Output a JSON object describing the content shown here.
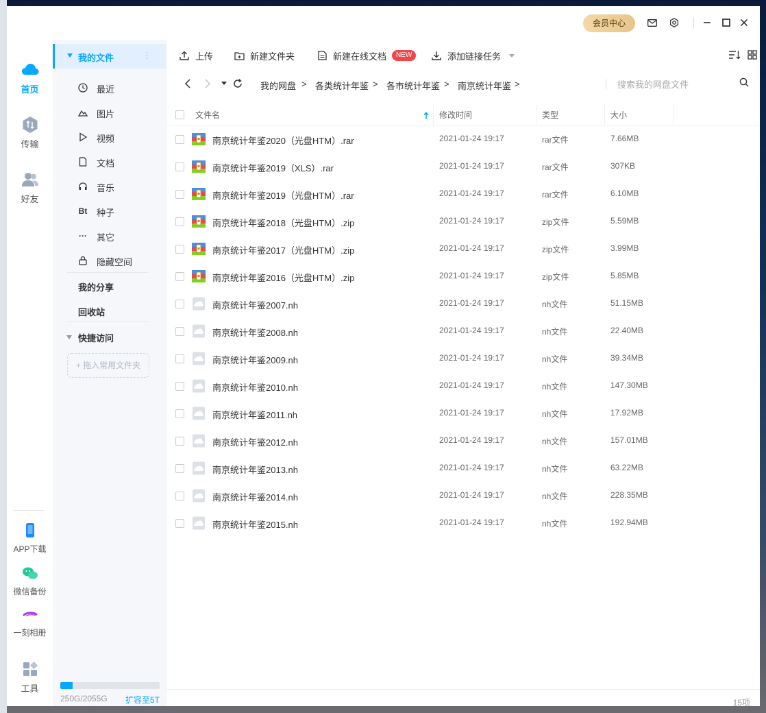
{
  "titlebar": {
    "vip_label": "会员中心",
    "icons": [
      "mail-icon",
      "settings-icon",
      "minimize-icon",
      "maximize-icon",
      "close-icon"
    ]
  },
  "leftnav": {
    "items": [
      {
        "label": "首页",
        "icon": "cloud-icon",
        "active": true
      },
      {
        "label": "传输",
        "icon": "transfer-icon",
        "active": false
      },
      {
        "label": "好友",
        "icon": "friends-icon",
        "active": false
      }
    ],
    "bottom": [
      {
        "label": "APP下载",
        "icon": "phone-icon"
      },
      {
        "label": "微信备份",
        "icon": "wechat-icon"
      },
      {
        "label": "一刻相册",
        "icon": "album-icon"
      },
      {
        "label": "工具",
        "icon": "tools-icon"
      }
    ]
  },
  "sidepanel": {
    "header": "我的文件",
    "items": [
      {
        "label": "最近",
        "icon": "clock-icon"
      },
      {
        "label": "图片",
        "icon": "image-icon"
      },
      {
        "label": "视频",
        "icon": "video-icon"
      },
      {
        "label": "文档",
        "icon": "document-icon"
      },
      {
        "label": "音乐",
        "icon": "headphones-icon"
      },
      {
        "label": "种子",
        "icon": "bt-icon",
        "glyph": "Bt"
      },
      {
        "label": "其它",
        "icon": "more-icon",
        "glyph": "···"
      },
      {
        "label": "隐藏空间",
        "icon": "lock-icon"
      }
    ],
    "my_share": "我的分享",
    "recycle": "回收站",
    "quick_access": "快捷访问",
    "drop_hint": "+ 拖入常用文件夹",
    "quota_text": "250G/2055G",
    "quota_fraction": 0.122,
    "expand_link": "扩容至5T"
  },
  "toolbar": {
    "upload": "上传",
    "new_folder": "新建文件夹",
    "new_doc": "新建在线文档",
    "new_badge": "NEW",
    "add_link": "添加链接任务"
  },
  "addressbar": {
    "crumbs": [
      "我的网盘",
      "各类统计年鉴",
      "各市统计年鉴",
      "南京统计年鉴"
    ],
    "sep": ">",
    "search_placeholder": "搜索我的网盘文件"
  },
  "table": {
    "headers": {
      "name": "文件名",
      "time": "修改时间",
      "type": "类型",
      "size": "大小"
    },
    "rows": [
      {
        "name": "南京统计年鉴2020（光盘HTM）.rar",
        "time": "2021-01-24 19:17",
        "type": "rar文件",
        "size": "7.66MB",
        "kind": "archive"
      },
      {
        "name": "南京统计年鉴2019（XLS）.rar",
        "time": "2021-01-24 19:17",
        "type": "rar文件",
        "size": "307KB",
        "kind": "archive"
      },
      {
        "name": "南京统计年鉴2019（光盘HTM）.rar",
        "time": "2021-01-24 19:17",
        "type": "rar文件",
        "size": "6.10MB",
        "kind": "archive"
      },
      {
        "name": "南京统计年鉴2018（光盘HTM）.zip",
        "time": "2021-01-24 19:17",
        "type": "zip文件",
        "size": "5.59MB",
        "kind": "archive"
      },
      {
        "name": "南京统计年鉴2017（光盘HTM）.zip",
        "time": "2021-01-24 19:17",
        "type": "zip文件",
        "size": "3.99MB",
        "kind": "archive"
      },
      {
        "name": "南京统计年鉴2016（光盘HTM）.zip",
        "time": "2021-01-24 19:17",
        "type": "zip文件",
        "size": "5.85MB",
        "kind": "archive"
      },
      {
        "name": "南京统计年鉴2007.nh",
        "time": "2021-01-24 19:17",
        "type": "nh文件",
        "size": "51.15MB",
        "kind": "unknown"
      },
      {
        "name": "南京统计年鉴2008.nh",
        "time": "2021-01-24 19:17",
        "type": "nh文件",
        "size": "22.40MB",
        "kind": "unknown"
      },
      {
        "name": "南京统计年鉴2009.nh",
        "time": "2021-01-24 19:17",
        "type": "nh文件",
        "size": "39.34MB",
        "kind": "unknown"
      },
      {
        "name": "南京统计年鉴2010.nh",
        "time": "2021-01-24 19:17",
        "type": "nh文件",
        "size": "147.30MB",
        "kind": "unknown"
      },
      {
        "name": "南京统计年鉴2011.nh",
        "time": "2021-01-24 19:17",
        "type": "nh文件",
        "size": "17.92MB",
        "kind": "unknown"
      },
      {
        "name": "南京统计年鉴2012.nh",
        "time": "2021-01-24 19:17",
        "type": "nh文件",
        "size": "157.01MB",
        "kind": "unknown"
      },
      {
        "name": "南京统计年鉴2013.nh",
        "time": "2021-01-24 19:17",
        "type": "nh文件",
        "size": "63.22MB",
        "kind": "unknown"
      },
      {
        "name": "南京统计年鉴2014.nh",
        "time": "2021-01-24 19:17",
        "type": "nh文件",
        "size": "228.35MB",
        "kind": "unknown"
      },
      {
        "name": "南京统计年鉴2015.nh",
        "time": "2021-01-24 19:17",
        "type": "nh文件",
        "size": "192.94MB",
        "kind": "unknown"
      }
    ]
  },
  "status": {
    "count": "15项"
  },
  "colors": {
    "accent": "#06a7ff",
    "badge": "#f2474a",
    "vip": "#e8c58a"
  }
}
